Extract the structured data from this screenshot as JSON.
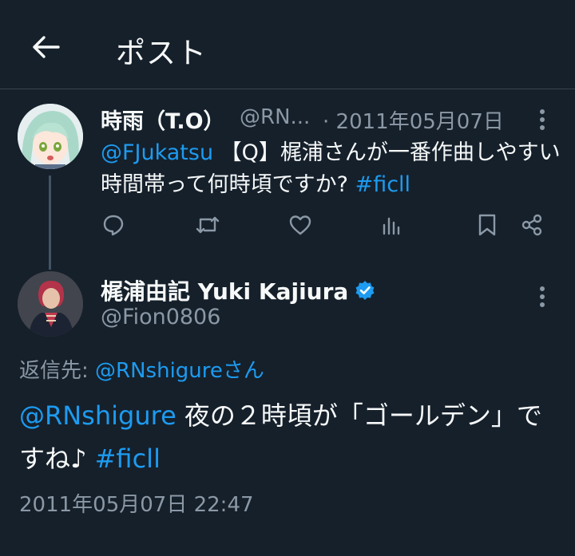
{
  "header": {
    "title": "ポスト"
  },
  "parent": {
    "name": "時雨（T.O）",
    "handle": "@RN...",
    "date": "· 2011年05月07日",
    "mention": "@FJukatsu",
    "text": " 【Q】梶浦さんが一番作曲しやすい時間帯って何時頃ですか? ",
    "hashtag": "#ficll"
  },
  "main": {
    "name": "梶浦由記 Yuki Kajiura",
    "handle": "@Fion0806",
    "reply_prefix": "返信先: ",
    "reply_user": "@RNshigureさん",
    "mention": "@RNshigure",
    "text": " 夜の２時頃が「ゴールデン」ですね♪  ",
    "hashtag": "#ficll",
    "timestamp": "2011年05月07日 22:47"
  },
  "icons": [
    "back-arrow-icon",
    "more-vertical-icon",
    "reply-icon",
    "retweet-icon",
    "like-icon",
    "views-icon",
    "bookmark-icon",
    "share-icon",
    "verified-badge-icon"
  ],
  "colors": {
    "background": "#15202b",
    "link": "#1d9bf0",
    "muted": "#8b98a5",
    "verified": "#1d9bf0",
    "divider": "#38444d"
  }
}
